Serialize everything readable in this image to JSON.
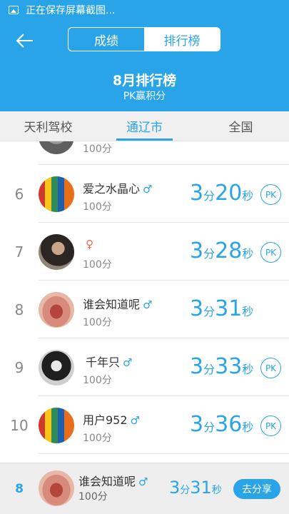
{
  "status_bar": {
    "text": "正在保存屏幕截图..."
  },
  "header": {
    "tabs": [
      "成绩",
      "排行榜"
    ],
    "title": "8月排行榜",
    "subtitle": "PK赢积分"
  },
  "scope_tabs": [
    "天利驾校",
    "通辽市",
    "全国"
  ],
  "rows": [
    {
      "rank": "",
      "name": "",
      "gender": "",
      "score": "100分",
      "time_min": "",
      "time_min_unit": "",
      "time_sec": "",
      "time_sec_unit": "",
      "pk": ""
    },
    {
      "rank": "6",
      "name": "爱之水晶心",
      "gender": "♂",
      "score": "100分",
      "time_min": "3",
      "time_min_unit": "分",
      "time_sec": "20",
      "time_sec_unit": "秒",
      "pk": "PK"
    },
    {
      "rank": "7",
      "name": "",
      "gender": "♀",
      "score": "100分",
      "time_min": "3",
      "time_min_unit": "分",
      "time_sec": "28",
      "time_sec_unit": "秒",
      "pk": "PK"
    },
    {
      "rank": "8",
      "name": "谁会知道呢",
      "gender": "♂",
      "score": "100分",
      "time_min": "3",
      "time_min_unit": "分",
      "time_sec": "31",
      "time_sec_unit": "秒",
      "pk": ""
    },
    {
      "rank": "9",
      "name": "千年只",
      "gender": "♂",
      "score": "100分",
      "time_min": "3",
      "time_min_unit": "分",
      "time_sec": "33",
      "time_sec_unit": "秒",
      "pk": "PK"
    },
    {
      "rank": "10",
      "name": "用户952",
      "gender": "♂",
      "score": "100分",
      "time_min": "3",
      "time_min_unit": "分",
      "time_sec": "36",
      "time_sec_unit": "秒",
      "pk": "PK"
    }
  ],
  "footer": {
    "rank": "8",
    "name": "谁会知道呢",
    "gender": "♂",
    "score": "100分",
    "time_min": "3",
    "time_min_unit": "分",
    "time_sec": "31",
    "time_sec_unit": "秒",
    "share_label": "去分享"
  },
  "colors": {
    "accent": "#2aa4e8",
    "female": "#f06a4a"
  }
}
